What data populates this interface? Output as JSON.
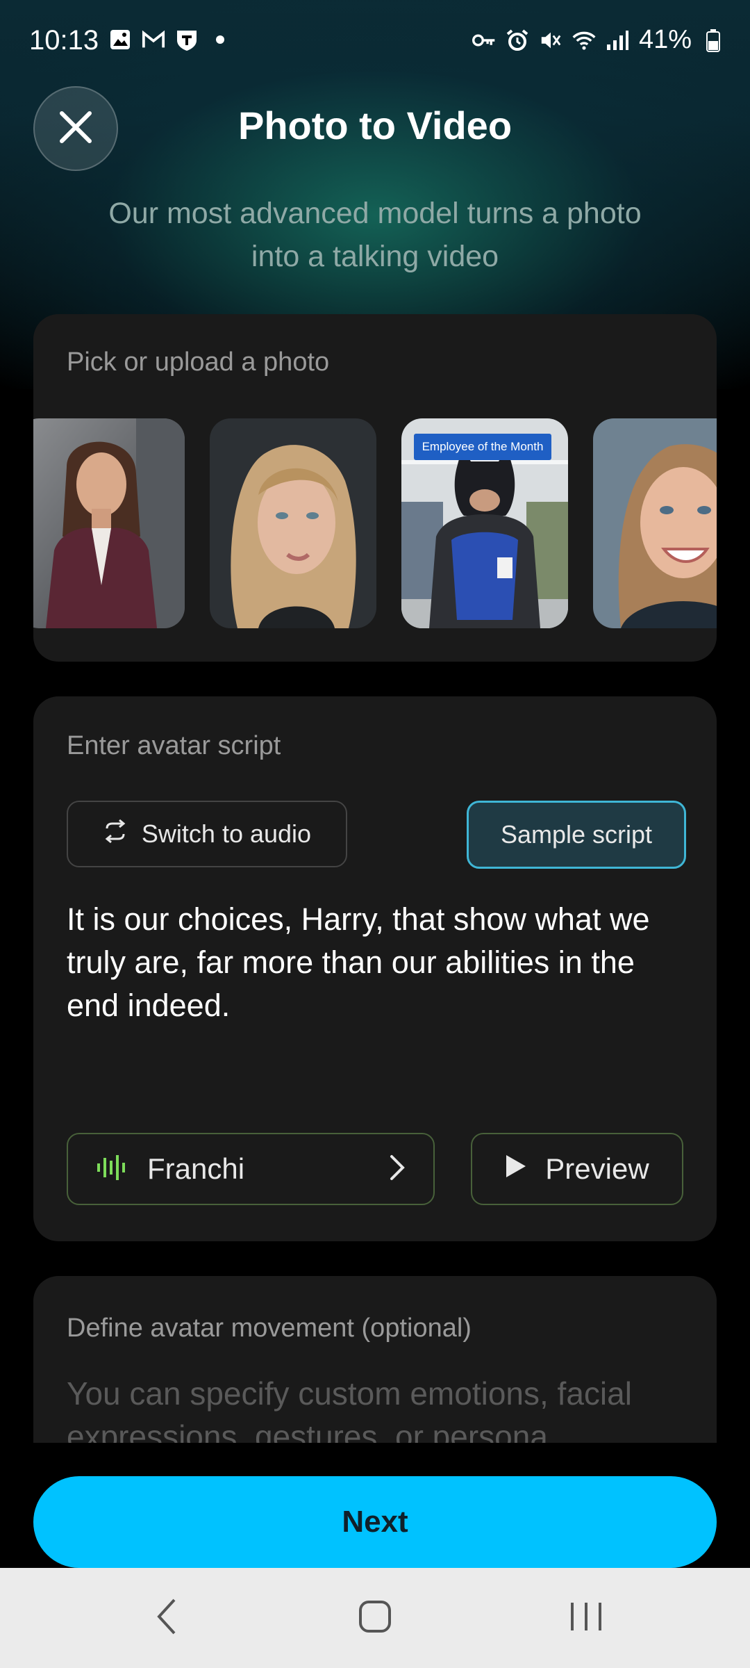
{
  "status_bar": {
    "time": "10:13",
    "left_icons": [
      "gallery-icon",
      "gmail-icon",
      "shield-app-icon",
      "dot-icon"
    ],
    "right_icons": [
      "key-icon",
      "alarm-icon",
      "mute-icon",
      "wifi-icon",
      "signal-icon"
    ],
    "battery": "41%"
  },
  "header": {
    "close_icon": "close-icon",
    "title": "Photo to Video",
    "subtitle": "Our most advanced model turns a photo into a talking video"
  },
  "photo_section": {
    "label": "Pick or upload a photo",
    "photos": [
      {
        "name": "woman-blazer-photo"
      },
      {
        "name": "blonde-woman-photo"
      },
      {
        "name": "batman-store-photo",
        "sign_text": "Employee of the Month"
      },
      {
        "name": "smiling-woman-photo"
      }
    ]
  },
  "script_section": {
    "label": "Enter avatar script",
    "switch_audio_label": "Switch to audio",
    "sample_script_label": "Sample script",
    "script_text": "It is our choices, Harry, that show what we truly are, far more than our abilities in the end indeed.",
    "voice_name": "Franchi",
    "preview_label": "Preview"
  },
  "movement_section": {
    "label": "Define avatar movement (optional)",
    "placeholder": "You can specify custom emotions, facial expressions, gestures, or persona"
  },
  "next_label": "Next",
  "colors": {
    "accent": "#00c2ff",
    "sample_border": "#3fb6d6",
    "voice_wave": "#7ddc5a",
    "card_bg": "#1a1a1a"
  }
}
